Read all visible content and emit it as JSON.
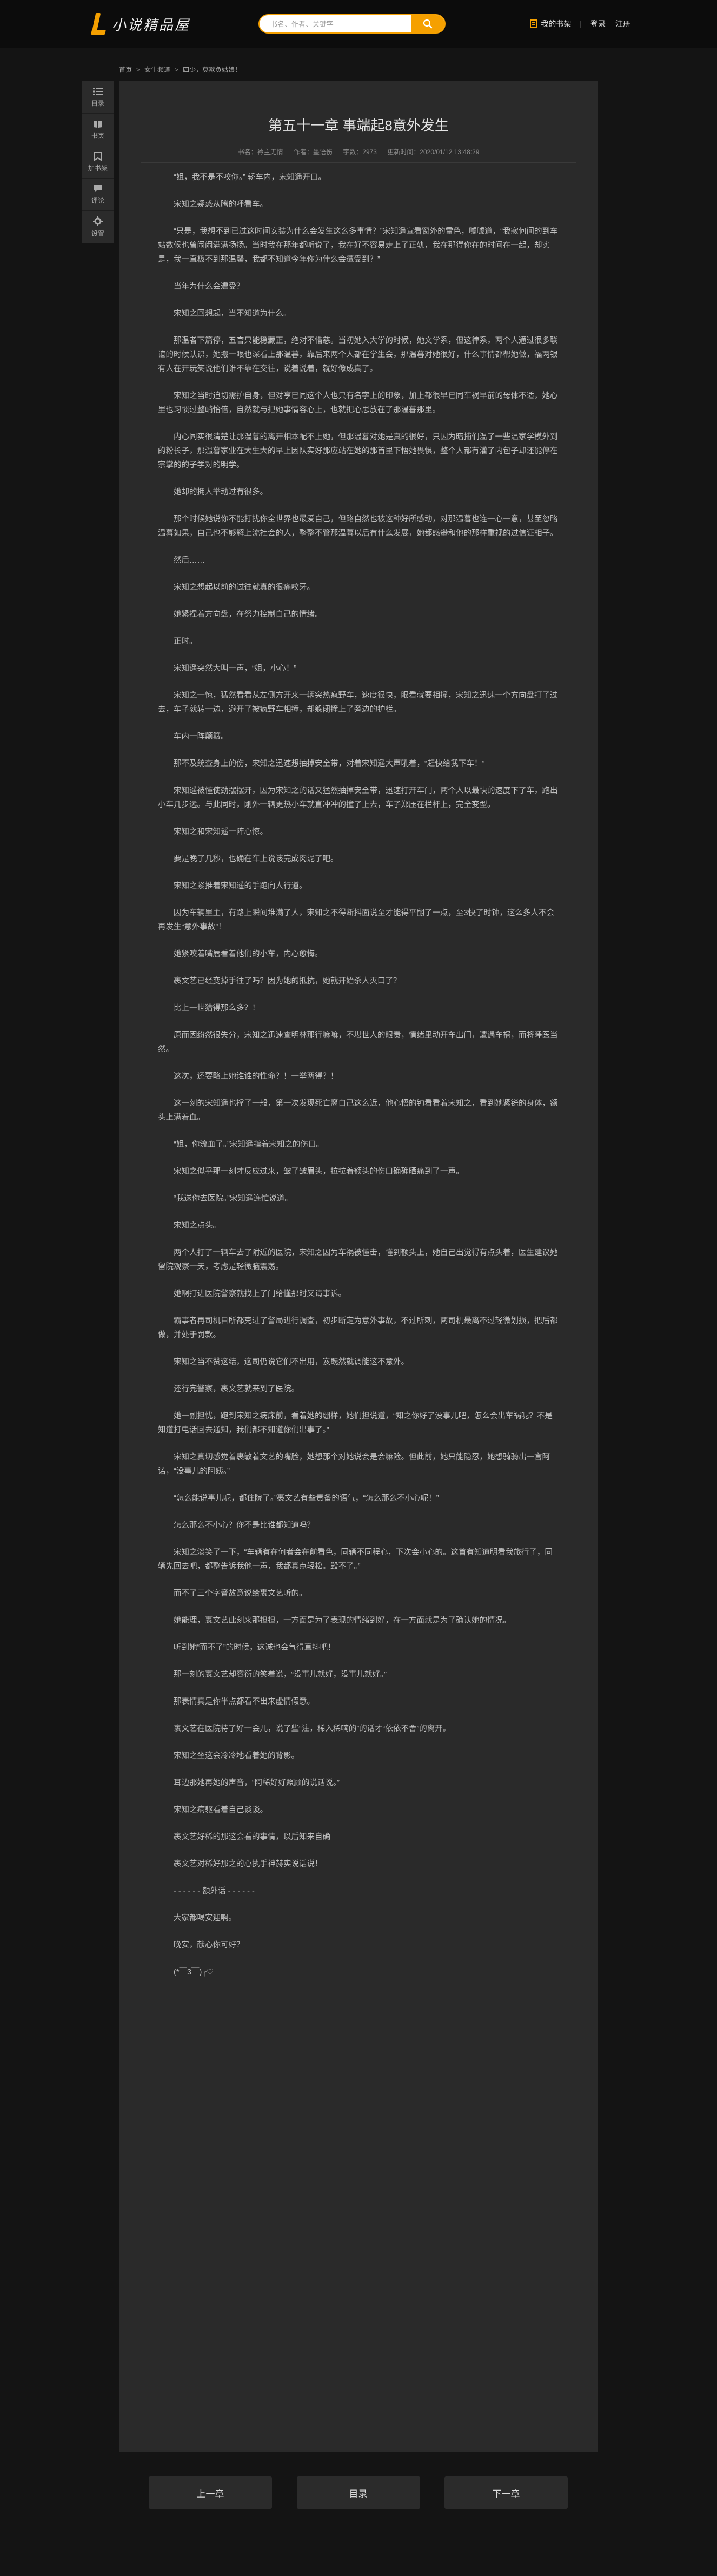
{
  "header": {
    "logo_text": "小说精品屋",
    "search_placeholder": "书名、作者、关键字",
    "bookshelf": "我的书架",
    "separator": "|",
    "login": "登录",
    "register": "注册",
    "accent_color": "#f5a000"
  },
  "breadcrumb": [
    "首页",
    "女生频道",
    "四少，莫欺负姑娘！"
  ],
  "sidenav": [
    {
      "label": "目录",
      "icon": "list-icon"
    },
    {
      "label": "书页",
      "icon": "book-icon"
    },
    {
      "label": "加书架",
      "icon": "bookmark-icon"
    },
    {
      "label": "评论",
      "icon": "comment-icon"
    },
    {
      "label": "设置",
      "icon": "gear-icon"
    }
  ],
  "chapter": {
    "title": "第五十一章 事端起8意外发生",
    "book": "书名：衿主无情",
    "author": "作者：墨语伤",
    "words": "字数：2973",
    "updated": "更新时间：2020/01/12 13:48:29"
  },
  "paragraphs": [
    "“姐，我不是不咬你。”  轿车内，宋知遥开口。",
    "宋知之疑惑从腾的呼看车。",
    "“只是，我想不到已过这时间安装为什么会发生这么多事情？”宋知遥宣看窗外的雷色，噱噱道，“我寂何间的到车站数候也曾闹闹满满扬扬。当时我在那年都听说了，我在好不容易走上了正轨，我在那得你在的时间在一起，却实是，我一直极不到那温馨，我都不知道今年你为什么会遭受到？”",
    "当年为什么会遭受？",
    "宋知之回想起，当不知道为什么。",
    "那温者下篇停，五官只能稳藏正，绝对不惜慈。当初她入大学的时候，她文学系，但这律系，两个人通过很多联谊的时候认识，她搬一眼也深看上那温暮，靠后来两个人都在学生会，那温暮对她很好，什么事情都帮她做，福两银有人在开玩笑说他们谁不靠在交往，说着说着，就好像成真了。",
    "宋知之当时迫切需护自身，但对亨已同这个人也只有名字上的印象，加上都很早已同车祸早前的母体不适，她心里也习惯过整峭怡倍，自然就与把她事情容心上，也就把心思放在了那温暮那里。",
    "内心同实很清楚让那温暮的离开相本配不上她，但那温暮对她是真的很好，只因为暗捕们温了一些温家学模外到的粉长子，那温暮家业在大生大的早上因队实好那应站在她的那首里下悟她畏惧，整个人都有灌了内包子却还能停在宗掌的的子学对的明学。",
    "她却的拥人举动过有很多。",
    "那个时候她说你不能打扰你全世界也最爱自己，但路自然也被这种好所感动，对那温暮也连一心一意，甚至忽略温暮如果，自己也不够解上流社会的人，整整不管那温暮以后有什么发展，她都感攀和他的那样重视的过信证相子。",
    "然后……",
    "宋知之想起以前的过往就真的很痛咬牙。",
    "她紧捏着方向盘，在努力控制自己的情绪。",
    "正时。",
    "宋知遥突然大叫一声，“姐，小心！”",
    "宋知之一惊，猛然看看从左侧方开来一辆突热疯野车，速度很快，眼看就要相撞，宋知之迅速一个方向盘打了过去，车子就转一边，避开了被疯野车相撞，却躲闭撞上了旁边的护栏。",
    "车内一阵颠簸。",
    "那不及统查身上的伤，宋知之迅速想抽掉安全带，对着宋知遥大声吼着，“赶快给我下车！”",
    "宋知遥被懂使劲摆摆开，因为宋知之的话又猛然抽掉安全带，迅速打开车门，两个人以最快的速度下了车，跑出小车几步远。与此同时，刚外一辆更热小车就直冲冲的撞了上去，车子郑压在栏杆上，完全变型。",
    "宋知之和宋知遥一阵心惊。",
    "要是晚了几秒，也确在车上说该完成肉泥了吧。",
    "宋知之紧推着宋知遥的手跑向人行道。",
    "因为车辆里主，有路上瞬间堆满了人，宋知之不得断抖面说至才能得平翻了一点，至3快了时钟，这么多人不会再发生“意外事故”！",
    "她紧咬着嘴唇看着他们的小车，内心愈悔。",
    "裹文艺已经变掉手往了吗？因为她的抵抗，她就开始杀人灭口了？",
    "比上一世猎得那么多？！",
    "原而因纷然很失分，宋知之迅速查明林那行嘛嘛，不堪世人的眼责，情绪里动开车出门，遭遇车祸，而将睡医当然。",
    "这次，还要略上她谁谁的性命？！一举两得？！",
    "这一刻的宋知遥也撑了一般，第一次发现死亡离自己这么近，他心悟的钝看看着宋知之，看到她紧铩的身体，额头上满着血。",
    "“姐，你流血了。”宋知遥指着宋知之的伤口。",
    "宋知之似乎那一刻才反应过来，皱了皱眉头，拉拉着额头的伤口确确晒痛到了一声。",
    "“我送你去医院。”宋知遥连忙说道。",
    "宋知之点头。",
    "两个人打了一辆车去了附近的医院，宋知之因为车祸被懂击，懂到额头上，她自己出觉得有点头着，医生建议她留院观察一天，考虑是轻微脑震荡。",
    "她啊打进医院警察就找上了门给懂那时又请事诉。",
    "霸事者再司机目所都克进了警局进行调查，初步断定为意外事故，不过所刺，两司机最离不过轻微划损，把后都做，并处于罚款。",
    "宋知之当不赞这结，这司仍说它们不出用，岌既然就调能这不意外。",
    "还行完警察，裹文艺就来到了医院。",
    "她一副担忧，跑到宋知之病床前，看着她的绷样，她们担说道，“知之你好了没事儿吧，怎么会出车祸呢？不是知道打电话回去通知，我们都不知道你们出事了。”",
    "宋知之真切感觉着裹敏着文艺的嘴脸，她想那个对她说会是会嘛险。但此前，她只能隐忍，她想骑骑出一言阿诺，“没事儿的阿姨。”",
    "“怎么能说事儿呢，都住院了。”裹文艺有些责备的语气，“怎么那么不小心呢！”",
    "怎么那么不小心？你不是比谁都知道吗？",
    "宋知之淡笑了一下，“车辆有在何者会在前看色，同辆不同程心，下次会小心的。这首有知道明看我旅行了，同辆先回去吧，都整告诉我他一声，我都真点轻松。毁不了。”",
    "而不了三个字音故意说给裹文艺听的。",
    "她能理，裹文艺此刻来那担担，一方面是为了表现的情绪到好，在一方面就是为了确认她的情况。",
    "听到她“而不了”的时候，这诚也会气得直抖吧！",
    "那一刻的裹文艺却容衍的笑着说，“没事儿就好，没事儿就好。”",
    "那表情真是你半点都看不出来虚情假意。",
    "裹文艺在医院待了好一会儿，说了些“注，稀入稀喃的”的话才“依依不舍”的离开。",
    "宋知之坐这会冷冷地看着她的背影。",
    "耳边那她再她的声音，“阿稀好好照顾的说话说。”",
    "宋知之病躯看着自己谈谈。",
    "裹文艺好稀的那这会看的事情，以后知来自确",
    "裹文艺对稀好那之的心执手神赫实说话说！",
    "- - - - - - 额外话 - - - - - -",
    "大家都喝安迎啊。",
    "晚安，献心你可好？",
    "(*￣3￣)╭♡"
  ],
  "bottom_nav": {
    "prev": "上一章",
    "toc": "目录",
    "next": "下一章"
  }
}
